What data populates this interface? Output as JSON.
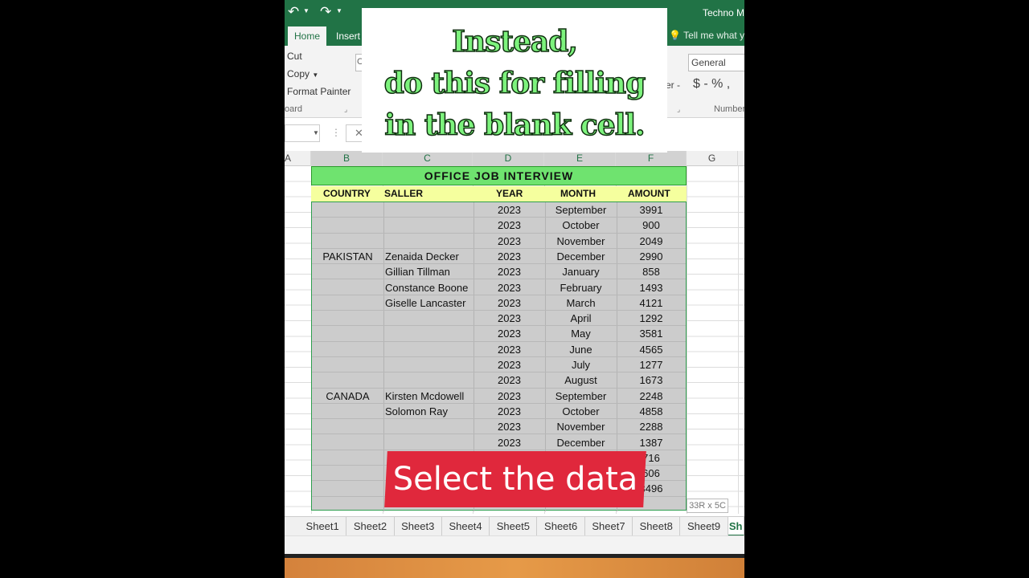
{
  "app": {
    "title": "Techno M"
  },
  "ribbon": {
    "tabs": [
      "Home",
      "Insert"
    ],
    "tell_me": "Tell me what y",
    "clipboard": {
      "cut": "Cut",
      "copy": "Copy",
      "format_painter": "Format Painter",
      "group_label": "oard"
    },
    "number_format": "General",
    "number_icons": "$ - % ,",
    "number_group_label": "Number",
    "partial_label": "er -"
  },
  "columns": [
    "A",
    "B",
    "C",
    "D",
    "E",
    "F",
    "G"
  ],
  "sheet": {
    "title": "OFFICE  JOB  INTERVIEW",
    "headers": [
      "COUNTRY",
      "SALLER",
      "YEAR",
      "MONTH",
      "AMOUNT"
    ],
    "rows": [
      [
        "",
        "",
        "2023",
        "September",
        "3991"
      ],
      [
        "",
        "",
        "2023",
        "October",
        "900"
      ],
      [
        "",
        "",
        "2023",
        "November",
        "2049"
      ],
      [
        "PAKISTAN",
        "Zenaida Decker",
        "2023",
        "December",
        "2990"
      ],
      [
        "",
        "Gillian Tillman",
        "2023",
        "January",
        "858"
      ],
      [
        "",
        "Constance Boone",
        "2023",
        "February",
        "1493"
      ],
      [
        "",
        "Giselle Lancaster",
        "2023",
        "March",
        "4121"
      ],
      [
        "",
        "",
        "2023",
        "April",
        "1292"
      ],
      [
        "",
        "",
        "2023",
        "May",
        "3581"
      ],
      [
        "",
        "",
        "2023",
        "June",
        "4565"
      ],
      [
        "",
        "",
        "2023",
        "July",
        "1277"
      ],
      [
        "",
        "",
        "2023",
        "August",
        "1673"
      ],
      [
        "CANADA",
        "Kirsten Mcdowell",
        "2023",
        "September",
        "2248"
      ],
      [
        "",
        "Solomon Ray",
        "2023",
        "October",
        "4858"
      ],
      [
        "",
        "",
        "2023",
        "November",
        "2288"
      ],
      [
        "",
        "",
        "2023",
        "December",
        "1387"
      ],
      [
        "",
        "",
        "",
        "",
        "716"
      ],
      [
        "",
        "",
        "",
        "",
        "606"
      ],
      [
        "",
        "",
        "",
        "",
        "3496"
      ]
    ],
    "selection_size": "33R x 5C"
  },
  "sheet_tabs": [
    "Sheet1",
    "Sheet2",
    "Sheet3",
    "Sheet4",
    "Sheet5",
    "Sheet6",
    "Sheet7",
    "Sheet8",
    "Sheet9",
    "Sh"
  ],
  "overlay": {
    "caption_lines": [
      "Instead,",
      "do this for filling",
      "in the blank cell."
    ],
    "banner": "Select the data"
  }
}
